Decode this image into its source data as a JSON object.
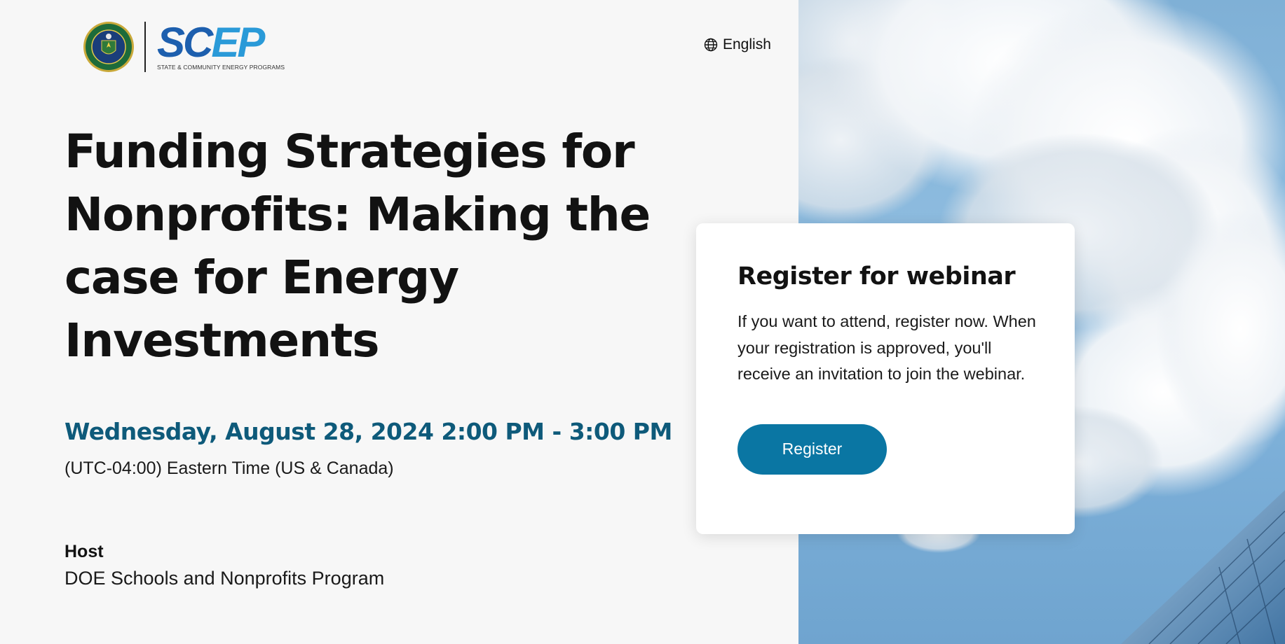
{
  "logo": {
    "seal_icon": "doe-seal-icon",
    "brand_sc": "SC",
    "brand_ep": "EP",
    "subtitle": "STATE & COMMUNITY ENERGY PROGRAMS",
    "colors": {
      "sc": "#1d5fae",
      "ep": "#2a9ad8"
    }
  },
  "language": {
    "icon": "globe-icon",
    "label": "English"
  },
  "event": {
    "title": "Funding Strategies for Nonprofits: Making the case for Energy Investments",
    "datetime": "Wednesday, August 28, 2024 2:00 PM - 3:00 PM",
    "timezone": "(UTC-04:00) Eastern Time (US & Canada)",
    "host_label": "Host",
    "host_name": "DOE Schools and Nonprofits Program"
  },
  "registration": {
    "heading": "Register for webinar",
    "description": "If you want to attend, register now. When your registration is approved, you'll receive an invitation to join the webinar.",
    "button_label": "Register"
  },
  "colors": {
    "accent": "#0a76a3",
    "date_text": "#0e5a7a",
    "background": "#f7f7f7"
  }
}
